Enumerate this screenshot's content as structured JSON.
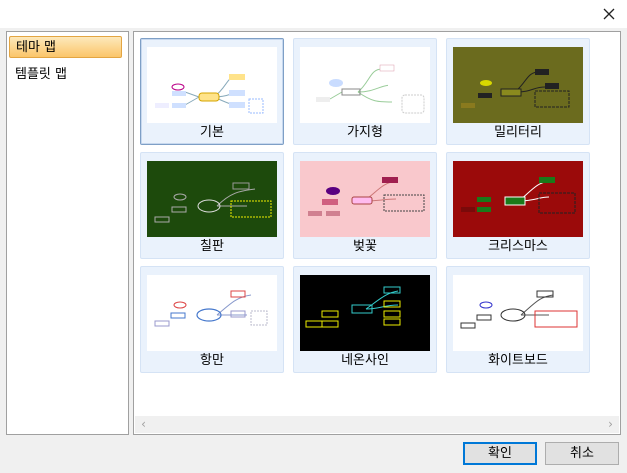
{
  "sidebar": {
    "items": [
      {
        "label": "테마 맵"
      },
      {
        "label": "템플릿 맵"
      }
    ]
  },
  "themes": [
    {
      "label": "기본"
    },
    {
      "label": "가지형"
    },
    {
      "label": "밀리터리"
    },
    {
      "label": "칠판"
    },
    {
      "label": "벚꽃"
    },
    {
      "label": "크리스마스"
    },
    {
      "label": "항만"
    },
    {
      "label": "네온사인"
    },
    {
      "label": "화이트보드"
    }
  ],
  "buttons": {
    "ok": "확인",
    "cancel": "취소"
  },
  "icons": {
    "close": "close-icon",
    "scroll_left": "chevron-left-icon",
    "scroll_right": "chevron-right-icon"
  },
  "colors": {
    "selection_highlight": "#fbc56a",
    "military_bg": "#6b6b1e",
    "chalkboard_bg": "#1d4a0c",
    "cherry_bg": "#f9c8cc",
    "christmas_bg": "#9b0a0a",
    "neon_bg": "#000000"
  }
}
